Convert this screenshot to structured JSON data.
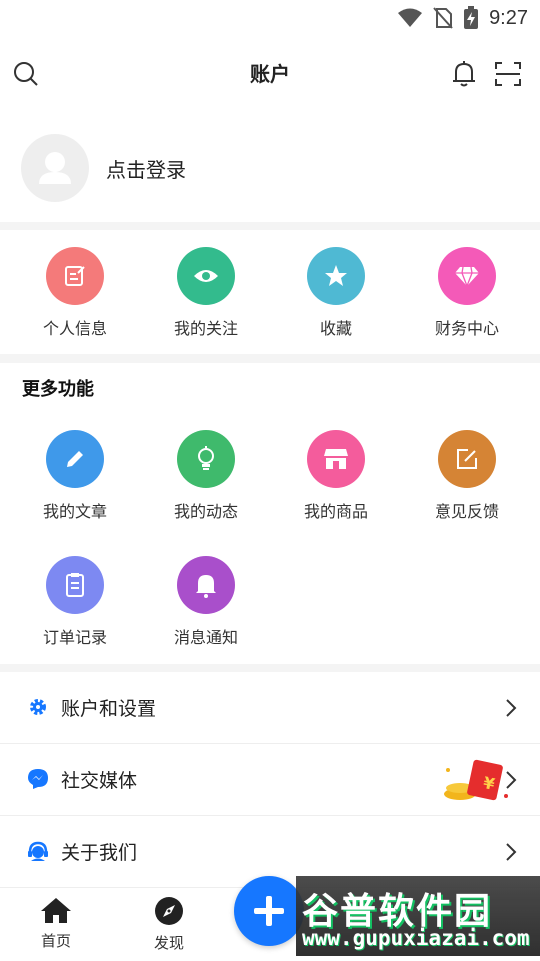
{
  "status_bar": {
    "time": "9:27"
  },
  "header": {
    "title": "账户"
  },
  "login": {
    "prompt": "点击登录"
  },
  "quick_actions": [
    {
      "label": "个人信息",
      "icon": "edit-profile-icon",
      "color": "#f47a7a"
    },
    {
      "label": "我的关注",
      "icon": "eye-icon",
      "color": "#33bb8d"
    },
    {
      "label": "收藏",
      "icon": "star-icon",
      "color": "#4fb9d3"
    },
    {
      "label": "财务中心",
      "icon": "diamond-icon",
      "color": "#f45ab8"
    }
  ],
  "more_features": {
    "title": "更多功能",
    "items": [
      {
        "label": "我的文章",
        "icon": "pencil-icon",
        "color": "#3f99ea"
      },
      {
        "label": "我的动态",
        "icon": "lightbulb-icon",
        "color": "#3fba6c"
      },
      {
        "label": "我的商品",
        "icon": "store-icon",
        "color": "#f45c9c"
      },
      {
        "label": "意见反馈",
        "icon": "feedback-edit-icon",
        "color": "#d58435"
      },
      {
        "label": "订单记录",
        "icon": "clipboard-icon",
        "color": "#7d89f2"
      },
      {
        "label": "消息通知",
        "icon": "bell-icon",
        "color": "#a94fcb"
      }
    ]
  },
  "menu_list": [
    {
      "label": "账户和设置",
      "icon": "gear-icon",
      "color": "#1677ff"
    },
    {
      "label": "社交媒体",
      "icon": "messenger-icon",
      "color": "#1677ff"
    },
    {
      "label": "关于我们",
      "icon": "support-agent-icon",
      "color": "#1677ff"
    }
  ],
  "tabbar": {
    "home_label": "首页",
    "discover_label": "发现"
  },
  "watermark": {
    "title": "谷普软件园",
    "url": "www.gupuxiazai.com"
  },
  "colors": {
    "accent": "#1677ff"
  }
}
